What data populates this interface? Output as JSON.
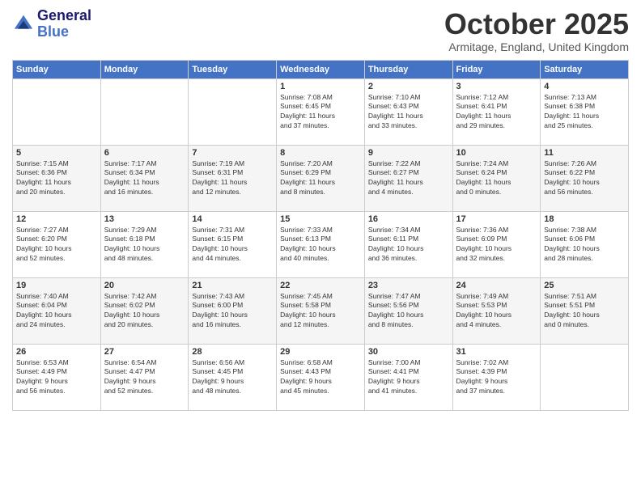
{
  "logo": {
    "line1": "General",
    "line2": "Blue"
  },
  "title": "October 2025",
  "subtitle": "Armitage, England, United Kingdom",
  "days_of_week": [
    "Sunday",
    "Monday",
    "Tuesday",
    "Wednesday",
    "Thursday",
    "Friday",
    "Saturday"
  ],
  "weeks": [
    [
      {
        "day": "",
        "info": ""
      },
      {
        "day": "",
        "info": ""
      },
      {
        "day": "",
        "info": ""
      },
      {
        "day": "1",
        "info": "Sunrise: 7:08 AM\nSunset: 6:45 PM\nDaylight: 11 hours\nand 37 minutes."
      },
      {
        "day": "2",
        "info": "Sunrise: 7:10 AM\nSunset: 6:43 PM\nDaylight: 11 hours\nand 33 minutes."
      },
      {
        "day": "3",
        "info": "Sunrise: 7:12 AM\nSunset: 6:41 PM\nDaylight: 11 hours\nand 29 minutes."
      },
      {
        "day": "4",
        "info": "Sunrise: 7:13 AM\nSunset: 6:38 PM\nDaylight: 11 hours\nand 25 minutes."
      }
    ],
    [
      {
        "day": "5",
        "info": "Sunrise: 7:15 AM\nSunset: 6:36 PM\nDaylight: 11 hours\nand 20 minutes."
      },
      {
        "day": "6",
        "info": "Sunrise: 7:17 AM\nSunset: 6:34 PM\nDaylight: 11 hours\nand 16 minutes."
      },
      {
        "day": "7",
        "info": "Sunrise: 7:19 AM\nSunset: 6:31 PM\nDaylight: 11 hours\nand 12 minutes."
      },
      {
        "day": "8",
        "info": "Sunrise: 7:20 AM\nSunset: 6:29 PM\nDaylight: 11 hours\nand 8 minutes."
      },
      {
        "day": "9",
        "info": "Sunrise: 7:22 AM\nSunset: 6:27 PM\nDaylight: 11 hours\nand 4 minutes."
      },
      {
        "day": "10",
        "info": "Sunrise: 7:24 AM\nSunset: 6:24 PM\nDaylight: 11 hours\nand 0 minutes."
      },
      {
        "day": "11",
        "info": "Sunrise: 7:26 AM\nSunset: 6:22 PM\nDaylight: 10 hours\nand 56 minutes."
      }
    ],
    [
      {
        "day": "12",
        "info": "Sunrise: 7:27 AM\nSunset: 6:20 PM\nDaylight: 10 hours\nand 52 minutes."
      },
      {
        "day": "13",
        "info": "Sunrise: 7:29 AM\nSunset: 6:18 PM\nDaylight: 10 hours\nand 48 minutes."
      },
      {
        "day": "14",
        "info": "Sunrise: 7:31 AM\nSunset: 6:15 PM\nDaylight: 10 hours\nand 44 minutes."
      },
      {
        "day": "15",
        "info": "Sunrise: 7:33 AM\nSunset: 6:13 PM\nDaylight: 10 hours\nand 40 minutes."
      },
      {
        "day": "16",
        "info": "Sunrise: 7:34 AM\nSunset: 6:11 PM\nDaylight: 10 hours\nand 36 minutes."
      },
      {
        "day": "17",
        "info": "Sunrise: 7:36 AM\nSunset: 6:09 PM\nDaylight: 10 hours\nand 32 minutes."
      },
      {
        "day": "18",
        "info": "Sunrise: 7:38 AM\nSunset: 6:06 PM\nDaylight: 10 hours\nand 28 minutes."
      }
    ],
    [
      {
        "day": "19",
        "info": "Sunrise: 7:40 AM\nSunset: 6:04 PM\nDaylight: 10 hours\nand 24 minutes."
      },
      {
        "day": "20",
        "info": "Sunrise: 7:42 AM\nSunset: 6:02 PM\nDaylight: 10 hours\nand 20 minutes."
      },
      {
        "day": "21",
        "info": "Sunrise: 7:43 AM\nSunset: 6:00 PM\nDaylight: 10 hours\nand 16 minutes."
      },
      {
        "day": "22",
        "info": "Sunrise: 7:45 AM\nSunset: 5:58 PM\nDaylight: 10 hours\nand 12 minutes."
      },
      {
        "day": "23",
        "info": "Sunrise: 7:47 AM\nSunset: 5:56 PM\nDaylight: 10 hours\nand 8 minutes."
      },
      {
        "day": "24",
        "info": "Sunrise: 7:49 AM\nSunset: 5:53 PM\nDaylight: 10 hours\nand 4 minutes."
      },
      {
        "day": "25",
        "info": "Sunrise: 7:51 AM\nSunset: 5:51 PM\nDaylight: 10 hours\nand 0 minutes."
      }
    ],
    [
      {
        "day": "26",
        "info": "Sunrise: 6:53 AM\nSunset: 4:49 PM\nDaylight: 9 hours\nand 56 minutes."
      },
      {
        "day": "27",
        "info": "Sunrise: 6:54 AM\nSunset: 4:47 PM\nDaylight: 9 hours\nand 52 minutes."
      },
      {
        "day": "28",
        "info": "Sunrise: 6:56 AM\nSunset: 4:45 PM\nDaylight: 9 hours\nand 48 minutes."
      },
      {
        "day": "29",
        "info": "Sunrise: 6:58 AM\nSunset: 4:43 PM\nDaylight: 9 hours\nand 45 minutes."
      },
      {
        "day": "30",
        "info": "Sunrise: 7:00 AM\nSunset: 4:41 PM\nDaylight: 9 hours\nand 41 minutes."
      },
      {
        "day": "31",
        "info": "Sunrise: 7:02 AM\nSunset: 4:39 PM\nDaylight: 9 hours\nand 37 minutes."
      },
      {
        "day": "",
        "info": ""
      }
    ]
  ]
}
